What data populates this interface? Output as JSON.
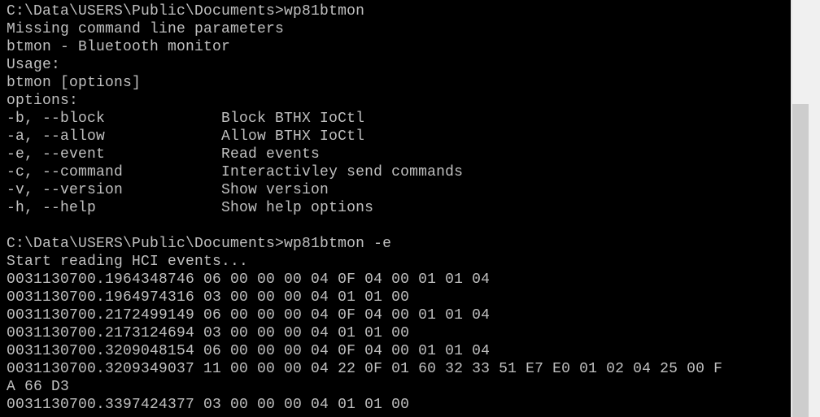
{
  "console": {
    "lines": [
      "C:\\Data\\USERS\\Public\\Documents>wp81btmon",
      "Missing command line parameters",
      "btmon - Bluetooth monitor",
      "Usage:",
      "btmon [options]",
      "options:",
      "-b, --block             Block BTHX IoCtl",
      "-a, --allow             Allow BTHX IoCtl",
      "-e, --event             Read events",
      "-c, --command           Interactivley send commands",
      "-v, --version           Show version",
      "-h, --help              Show help options",
      "",
      "C:\\Data\\USERS\\Public\\Documents>wp81btmon -e",
      "Start reading HCI events...",
      "0031130700.1964348746 06 00 00 00 04 0F 04 00 01 01 04",
      "0031130700.1964974316 03 00 00 00 04 01 01 00",
      "0031130700.2172499149 06 00 00 00 04 0F 04 00 01 01 04",
      "0031130700.2173124694 03 00 00 00 04 01 01 00",
      "0031130700.3209048154 06 00 00 00 04 0F 04 00 01 01 04",
      "0031130700.3209349037 11 00 00 00 04 22 0F 01 60 32 33 51 E7 E0 01 02 04 25 00 F",
      "A 66 D3",
      "0031130700.3397424377 03 00 00 00 04 01 01 00"
    ]
  }
}
